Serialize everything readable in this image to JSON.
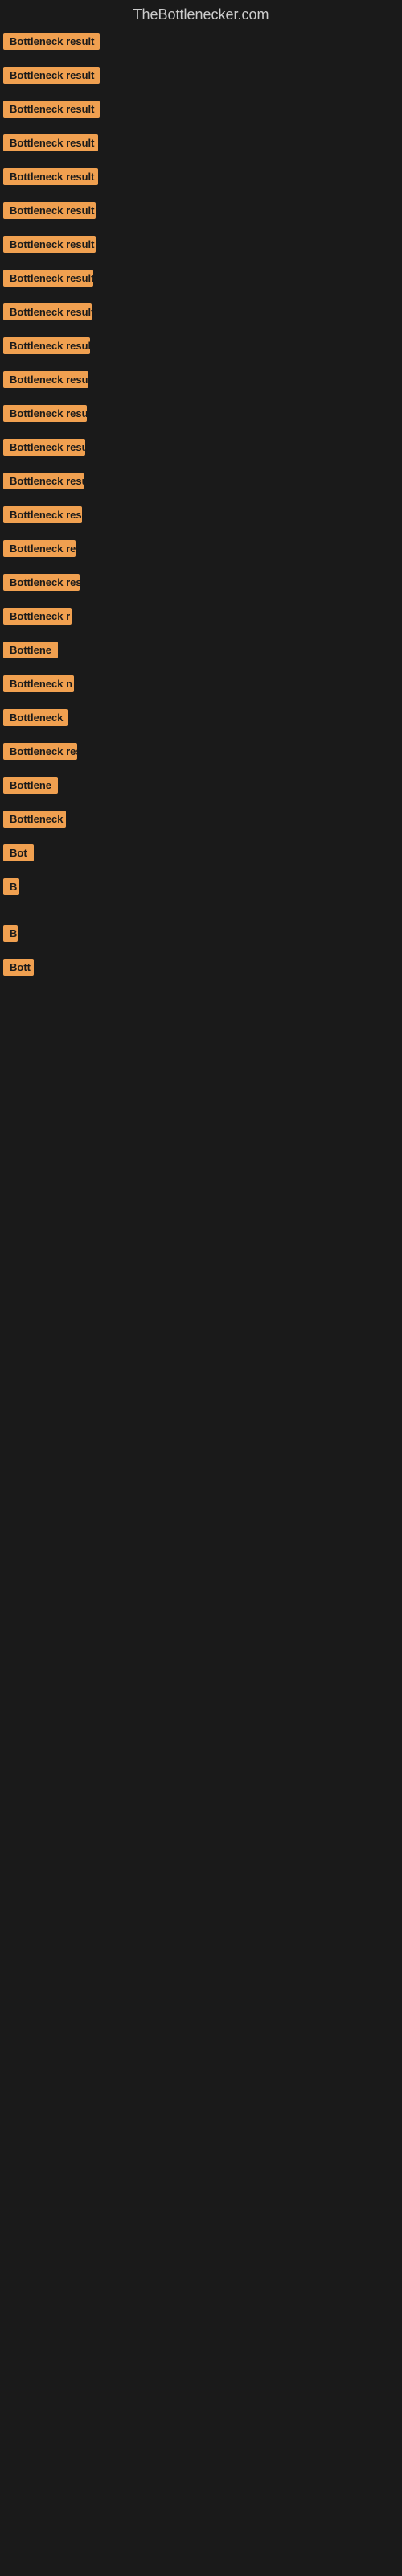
{
  "site": {
    "title": "TheBottlenecker.com"
  },
  "items": [
    {
      "label": "Bottleneck result",
      "width": 120
    },
    {
      "label": "Bottleneck result",
      "width": 120
    },
    {
      "label": "Bottleneck result",
      "width": 120
    },
    {
      "label": "Bottleneck result",
      "width": 118
    },
    {
      "label": "Bottleneck result",
      "width": 118
    },
    {
      "label": "Bottleneck result",
      "width": 115
    },
    {
      "label": "Bottleneck result",
      "width": 115
    },
    {
      "label": "Bottleneck result",
      "width": 112
    },
    {
      "label": "Bottleneck result",
      "width": 110
    },
    {
      "label": "Bottleneck result",
      "width": 108
    },
    {
      "label": "Bottleneck result",
      "width": 106
    },
    {
      "label": "Bottleneck result",
      "width": 104
    },
    {
      "label": "Bottleneck result",
      "width": 102
    },
    {
      "label": "Bottleneck result",
      "width": 100
    },
    {
      "label": "Bottleneck result",
      "width": 98
    },
    {
      "label": "Bottleneck re",
      "width": 90
    },
    {
      "label": "Bottleneck result",
      "width": 95
    },
    {
      "label": "Bottleneck r",
      "width": 85
    },
    {
      "label": "Bottlene",
      "width": 75
    },
    {
      "label": "Bottleneck n",
      "width": 88
    },
    {
      "label": "Bottleneck",
      "width": 80
    },
    {
      "label": "Bottleneck res",
      "width": 92
    },
    {
      "label": "Bottlene",
      "width": 72
    },
    {
      "label": "Bottleneck",
      "width": 78
    },
    {
      "label": "Bot",
      "width": 40
    },
    {
      "label": "B",
      "width": 20
    },
    {
      "label": "",
      "width": 0
    },
    {
      "label": "B",
      "width": 18
    },
    {
      "label": "Bott",
      "width": 38
    },
    {
      "label": "",
      "width": 0
    },
    {
      "label": "",
      "width": 0
    },
    {
      "label": "",
      "width": 0
    }
  ]
}
